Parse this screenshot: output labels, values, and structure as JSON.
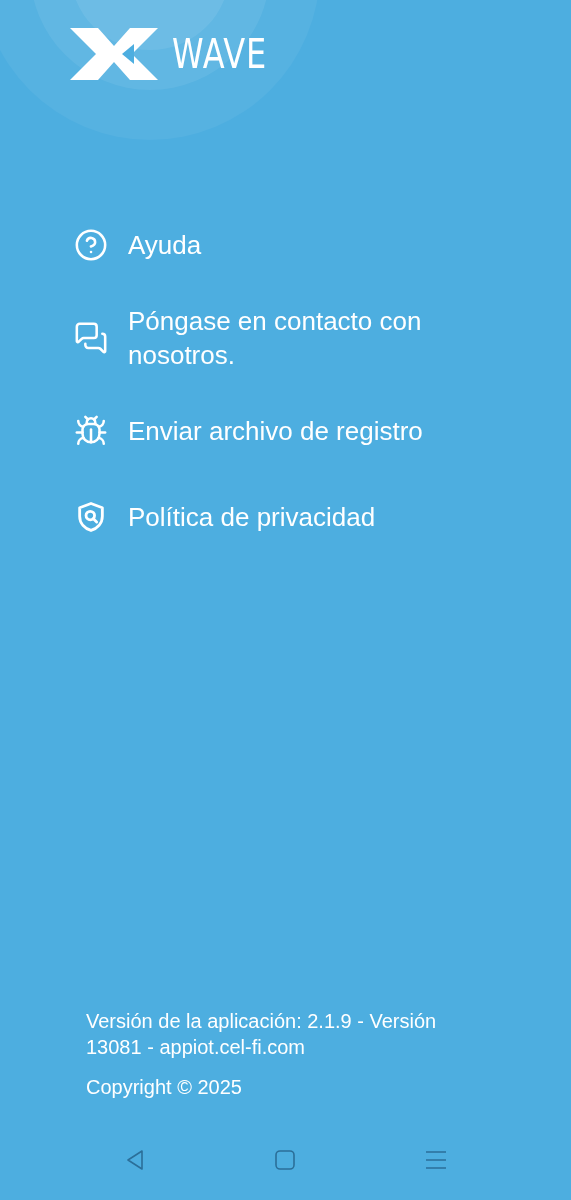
{
  "logo": {
    "text": "WAVE"
  },
  "menu": [
    {
      "kind": "help",
      "label": "Ayuda"
    },
    {
      "kind": "contact",
      "label": "Póngase en contacto con nosotros."
    },
    {
      "kind": "log",
      "label": "Enviar archivo de registro"
    },
    {
      "kind": "privacy",
      "label": "Política de privacidad"
    }
  ],
  "footer": {
    "version": "Versión de la aplicación: 2.1.9 - Versión 13081 - appiot.cel-fi.com",
    "copyright": "Copyright © 2025"
  }
}
